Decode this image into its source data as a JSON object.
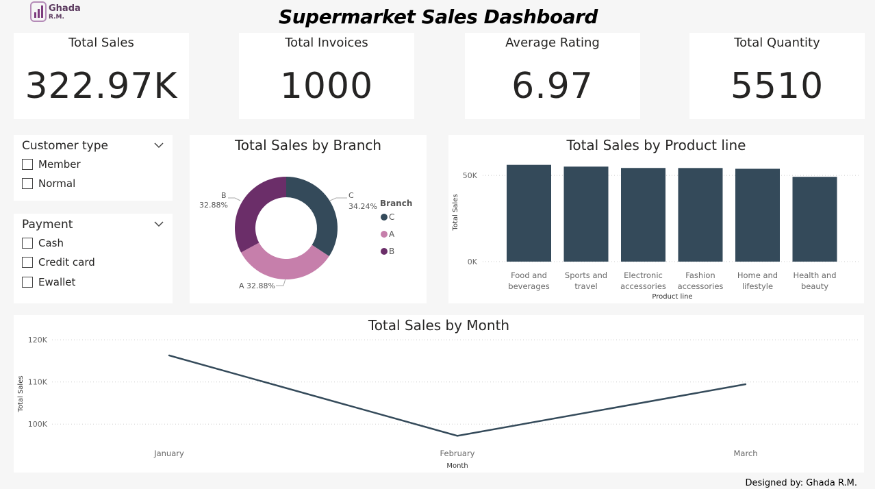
{
  "logo": {
    "name": "Ghada",
    "sub": "R.M."
  },
  "title": "Supermarket Sales Dashboard",
  "kpis": [
    {
      "label": "Total Sales",
      "value": "322.97K"
    },
    {
      "label": "Total Invoices",
      "value": "1000"
    },
    {
      "label": "Average Rating",
      "value": "6.97"
    },
    {
      "label": "Total Quantity",
      "value": "5510"
    }
  ],
  "slicers": {
    "customer": {
      "title": "Customer type",
      "options": [
        "Member",
        "Normal"
      ]
    },
    "payment": {
      "title": "Payment",
      "options": [
        "Cash",
        "Credit card",
        "Ewallet"
      ]
    }
  },
  "credit": "Designed by: Ghada R.M.",
  "colors": {
    "navy": "#344a5a",
    "pink": "#c67fab",
    "purple": "#6b2e69"
  },
  "chart_data": [
    {
      "type": "pie",
      "title": "Total Sales by Branch",
      "legend_title": "Branch",
      "legend_position": "right",
      "slices": [
        {
          "label": "C",
          "value": 34.24,
          "pct_label": "34.24%",
          "color": "#344a5a"
        },
        {
          "label": "A",
          "value": 32.88,
          "pct_label": "32.88%",
          "color": "#c67fab"
        },
        {
          "label": "B",
          "value": 32.88,
          "pct_label": "32.88%",
          "color": "#6b2e69"
        }
      ]
    },
    {
      "type": "bar",
      "title": "Total Sales by Product line",
      "xlabel": "Product line",
      "ylabel": "Total Sales",
      "categories": [
        "Food and beverages",
        "Sports and travel",
        "Electronic accessories",
        "Fashion accessories",
        "Home and lifestyle",
        "Health and beauty"
      ],
      "category_lines": [
        [
          "Food and",
          "beverages"
        ],
        [
          "Sports and",
          "travel"
        ],
        [
          "Electronic",
          "accessories"
        ],
        [
          "Fashion",
          "accessories"
        ],
        [
          "Home and",
          "lifestyle"
        ],
        [
          "Health and",
          "beauty"
        ]
      ],
      "values": [
        56145,
        55123,
        54338,
        54306,
        53862,
        49194
      ],
      "ylim": [
        0,
        60000
      ],
      "yticks": [
        {
          "value": 0,
          "label": "0K"
        },
        {
          "value": 50000,
          "label": "50K"
        }
      ],
      "grid": true
    },
    {
      "type": "line",
      "title": "Total Sales by Month",
      "xlabel": "Month",
      "ylabel": "Total Sales",
      "categories": [
        "January",
        "February",
        "March"
      ],
      "series": [
        {
          "values": [
            116291,
            97219,
            109456
          ]
        }
      ],
      "ylim": [
        95000,
        121000
      ],
      "yticks": [
        {
          "value": 100000,
          "label": "100K"
        },
        {
          "value": 110000,
          "label": "110K"
        },
        {
          "value": 120000,
          "label": "120K"
        }
      ],
      "grid": true
    }
  ]
}
